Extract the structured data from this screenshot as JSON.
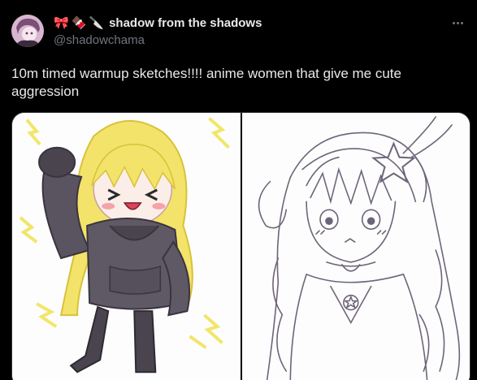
{
  "user": {
    "emoji_1": "🎀",
    "emoji_2": "🍫",
    "emoji_3": "🔪",
    "display_name": "shadow from the shadows",
    "handle": "@shadowchama"
  },
  "post": {
    "text": "10m timed warmup sketches!!!! anime women that give me cute aggression"
  },
  "colors": {
    "background": "#000000",
    "text_primary": "#e7e9ea",
    "text_secondary": "#71767b",
    "border": "#2f3336"
  },
  "icons": {
    "more": "more-horizontal-icon"
  }
}
